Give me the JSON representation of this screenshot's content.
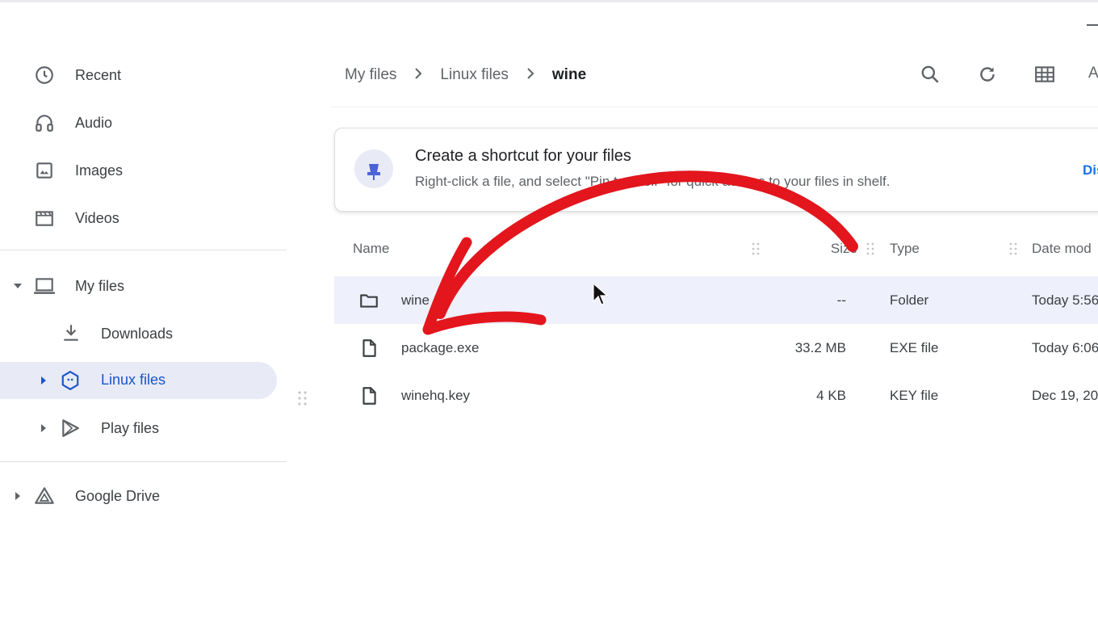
{
  "sidebar": {
    "items": [
      {
        "label": "Recent",
        "icon": "clock-icon"
      },
      {
        "label": "Audio",
        "icon": "headphones-icon"
      },
      {
        "label": "Images",
        "icon": "image-icon"
      },
      {
        "label": "Videos",
        "icon": "video-icon"
      },
      {
        "label": "My files",
        "icon": "laptop-icon"
      },
      {
        "label": "Downloads",
        "icon": "download-icon"
      },
      {
        "label": "Linux files",
        "icon": "penguin-icon",
        "selected": true
      },
      {
        "label": "Play files",
        "icon": "play-store-icon"
      },
      {
        "label": "Google Drive",
        "icon": "drive-icon"
      }
    ]
  },
  "breadcrumb": {
    "items": [
      "My files",
      "Linux files",
      "wine"
    ],
    "separator": ">"
  },
  "toolbar": {
    "buttons": [
      "search-icon",
      "refresh-icon",
      "grid-view-icon"
    ],
    "partial_label": "A"
  },
  "banner": {
    "title": "Create a shortcut for your files",
    "text": "Right-click a file, and select \"Pin to shelf\" for quick access to your files in shelf.",
    "dismiss_label": "Dis"
  },
  "table": {
    "columns": [
      "Name",
      "Size",
      "Type",
      "Date mod"
    ],
    "rows": [
      {
        "name": "wine",
        "size": "--",
        "type": "Folder",
        "date": "Today 5:56",
        "icon": "folder-icon",
        "selected": true
      },
      {
        "name": "package.exe",
        "size": "33.2 MB",
        "type": "EXE file",
        "date": "Today 6:06",
        "icon": "file-icon"
      },
      {
        "name": "winehq.key",
        "size": "4 KB",
        "type": "KEY file",
        "date": "Dec 19, 20",
        "icon": "file-icon"
      }
    ]
  },
  "colors": {
    "accent": "#1a56c9",
    "selection": "#e8eaf6",
    "annotation_arrow": "#e3161d"
  }
}
